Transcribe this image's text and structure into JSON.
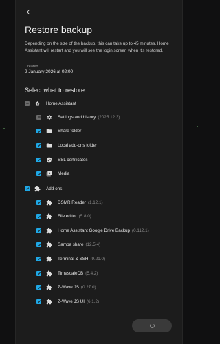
{
  "dialog": {
    "title": "Restore backup",
    "description": "Depending on the size of the backup, this can take up to 45 minutes. Home Assistant will restart and you will see the login screen when it's restored.",
    "created_label": "Created",
    "created_value": "2 January 2026 at 02:00",
    "section_title": "Select what to restore"
  },
  "home_assistant": {
    "label": "Home Assistant",
    "state": "indeterminate",
    "items": [
      {
        "label": "Settings and history",
        "version": "(2025.12.3)",
        "icon": "gear-icon",
        "state": "indeterminate"
      },
      {
        "label": "Share folder",
        "version": "",
        "icon": "folder-icon",
        "state": "checked"
      },
      {
        "label": "Local add-ons folder",
        "version": "",
        "icon": "folder-icon",
        "state": "checked"
      },
      {
        "label": "SSL certificates",
        "version": "",
        "icon": "shield-check-icon",
        "state": "checked"
      },
      {
        "label": "Media",
        "version": "",
        "icon": "media-icon",
        "state": "checked"
      }
    ]
  },
  "addons": {
    "label": "Add-ons",
    "state": "checked",
    "items": [
      {
        "label": "DSMR Reader",
        "version": "(1.12.1)",
        "icon": "puzzle-icon",
        "state": "checked"
      },
      {
        "label": "File editor",
        "version": "(5.8.0)",
        "icon": "puzzle-icon",
        "state": "checked"
      },
      {
        "label": "Home Assistant Google Drive Backup",
        "version": "(0.112.1)",
        "icon": "puzzle-icon",
        "state": "checked"
      },
      {
        "label": "Samba share",
        "version": "(12.5.4)",
        "icon": "puzzle-icon",
        "state": "checked"
      },
      {
        "label": "Terminal & SSH",
        "version": "(9.21.0)",
        "icon": "puzzle-icon",
        "state": "checked"
      },
      {
        "label": "TimescaleDB",
        "version": "(5.4.2)",
        "icon": "puzzle-icon",
        "state": "checked"
      },
      {
        "label": "Z-Wave JS",
        "version": "(0.27.0)",
        "icon": "puzzle-icon",
        "state": "checked"
      },
      {
        "label": "Z-Wave JS UI",
        "version": "(6.1.2)",
        "icon": "puzzle-icon",
        "state": "checked"
      }
    ]
  },
  "colors": {
    "accent": "#1fa8e6",
    "indeterminate": "#6a6a6a",
    "surface": "#1c1c1c",
    "background": "#101011"
  },
  "restore_button": {
    "state": "loading"
  }
}
